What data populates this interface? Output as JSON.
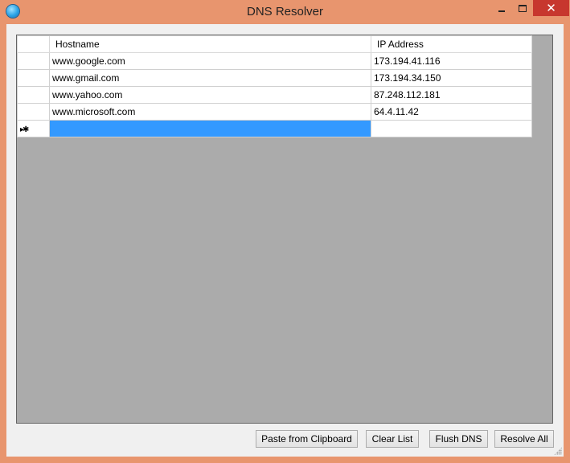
{
  "window": {
    "title": "DNS Resolver",
    "close_glyph": "✕"
  },
  "grid": {
    "columns": [
      "Hostname",
      "IP Address"
    ],
    "rows": [
      {
        "hostname": "www.google.com",
        "ip": "173.194.41.116"
      },
      {
        "hostname": "www.gmail.com",
        "ip": "173.194.34.150"
      },
      {
        "hostname": "www.yahoo.com",
        "ip": "87.248.112.181"
      },
      {
        "hostname": "www.microsoft.com",
        "ip": "64.4.11.42"
      }
    ],
    "new_row_indicator": "▸✱"
  },
  "buttons": {
    "paste": "Paste from Clipboard",
    "clear": "Clear List",
    "flush": "Flush DNS",
    "resolve": "Resolve All"
  },
  "colors": {
    "frame": "#e8956e",
    "close_button": "#c7372e",
    "selection": "#3399ff",
    "grid_background": "#ababab"
  }
}
